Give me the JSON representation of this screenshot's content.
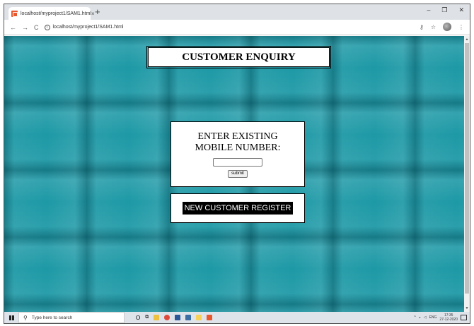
{
  "browser": {
    "tab_title": "localhost/myproject1/SAM1.html",
    "tab_close": "×",
    "new_tab": "+",
    "url": "localhost/myproject1/SAM1.html",
    "win_min": "–",
    "win_max": "❐",
    "win_close": "✕"
  },
  "page": {
    "header_title": "CUSTOMER ENQUIRY",
    "enquiry_label": "ENTER EXISTING MOBILE NUMBER:",
    "mobile_input_value": "",
    "submit_label": "submit",
    "register_label": "NEW CUSTOMER REGISTER"
  },
  "taskbar": {
    "search_placeholder": "Type here to search",
    "lang": "ENG",
    "time": "17:35",
    "date": "27-12-2020"
  },
  "colors": {
    "page_background": "#1d99a6",
    "button_background": "#000000"
  }
}
